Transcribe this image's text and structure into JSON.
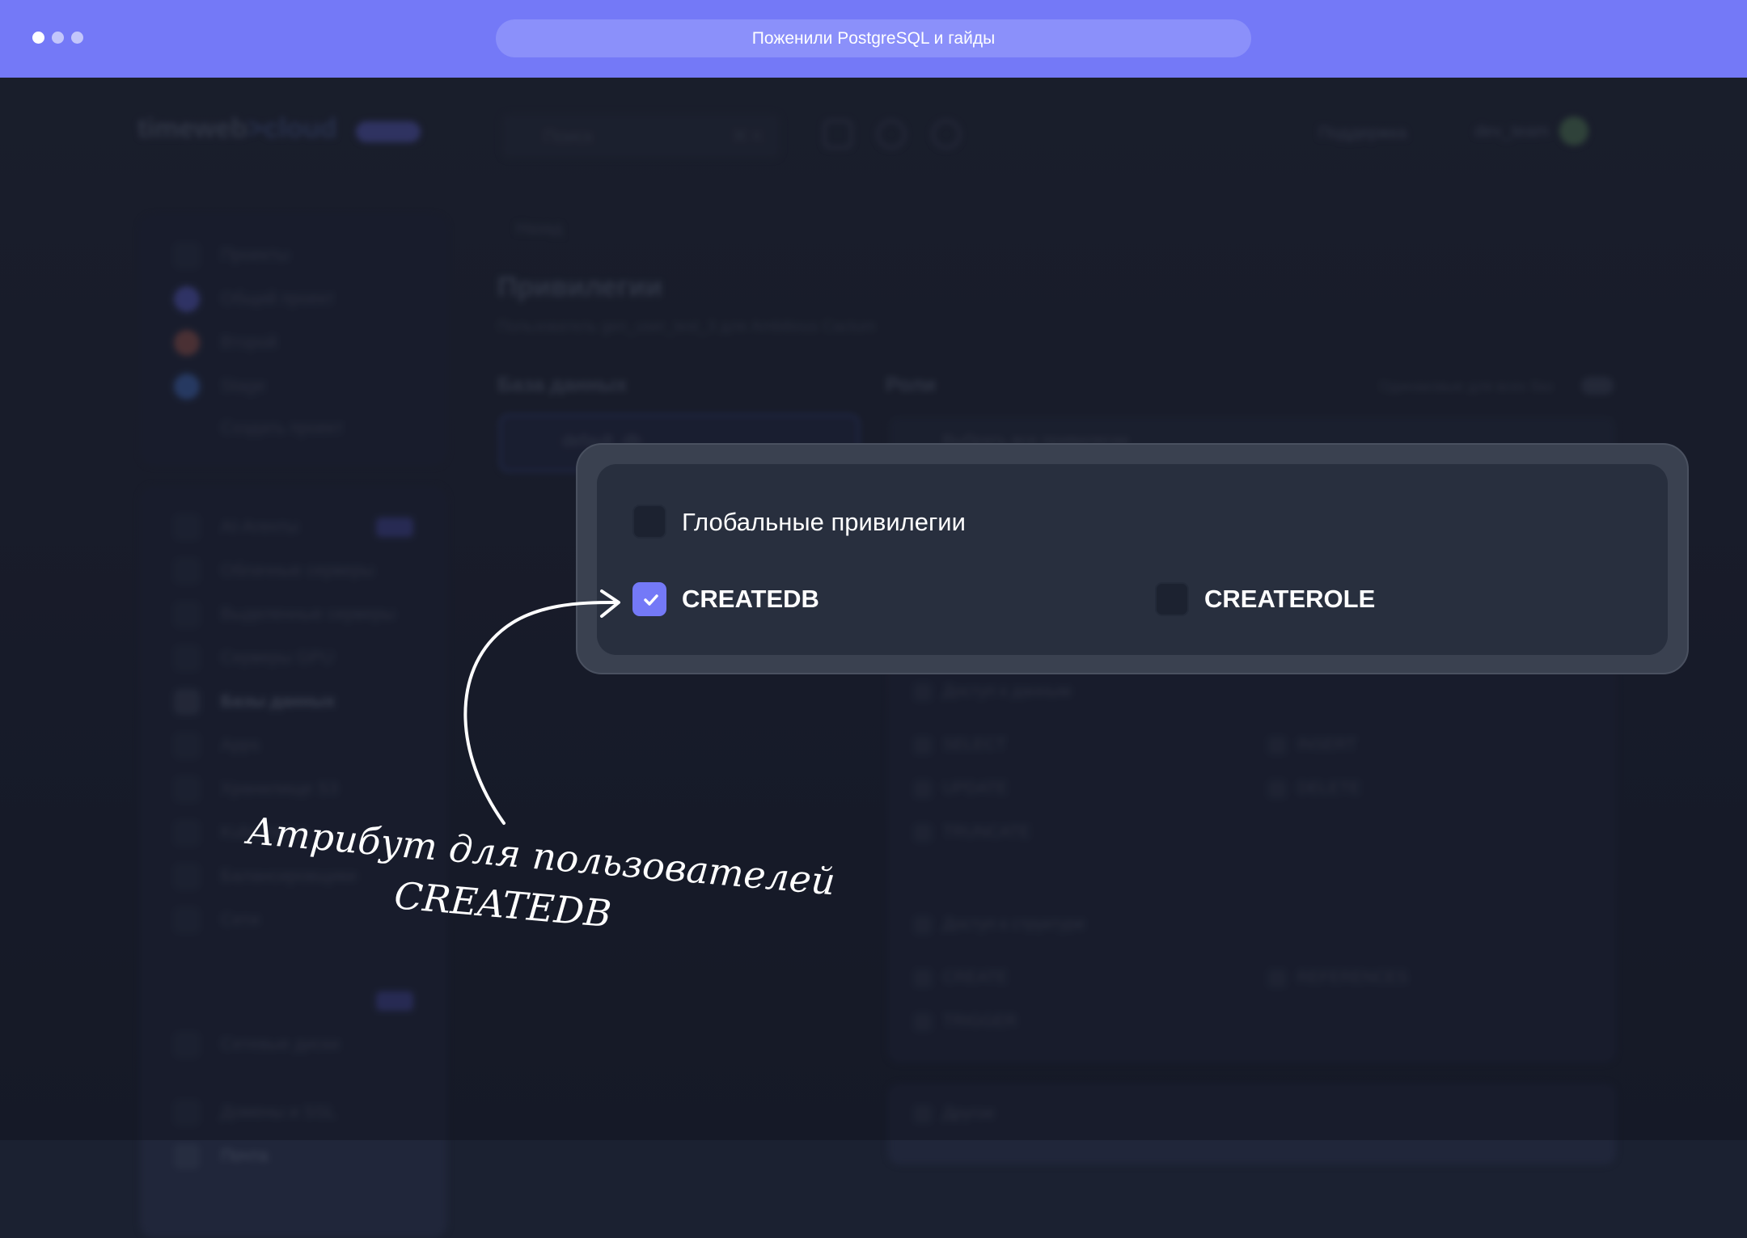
{
  "browser": {
    "url_title": "Поженили PostgreSQL и гайды"
  },
  "header": {
    "logo": "timeweb",
    "logo_suffix": ">cloud",
    "search_placeholder": "Поиск",
    "search_shortcut": "⌘ K",
    "support_label": "Поддержка",
    "user_name": "dev_team"
  },
  "sidebar": {
    "projects_title": "Проекты",
    "projects": [
      "Общий проект",
      "Второй",
      "Stage"
    ],
    "create_project": "Создать проект",
    "items": [
      "AI-Агенты",
      "Облачные серверы",
      "Выделенные серверы",
      "Серверы GPU",
      "Базы данных",
      "Apps",
      "Хранилище S3",
      "Kubernetes",
      "Балансировщики",
      "Сети",
      "Сетевые диски"
    ],
    "items_bottom": [
      "Домены и SSL",
      "Почта",
      "Личная сеть"
    ],
    "new_badge": "NEW"
  },
  "main": {
    "back_label": "Назад",
    "title": "Привилегии",
    "subtitle": "Пользователь gen_user_test_3 для Ambitious Cactum",
    "db_label": "База данных",
    "db_value": "default_db",
    "roles_label": "Роли",
    "same_for_all": "Одинаковые для всех баз",
    "roles_placeholder": "Выбрать все привилегии",
    "data_access": "Доступ к данным",
    "data_privs": [
      "SELECT",
      "INSERT",
      "UPDATE",
      "DELETE",
      "TRUNCATE"
    ],
    "structure_access": "Доступ к структуре",
    "structure_privs": [
      "CREATE",
      "REFERENCES",
      "TRIGGER"
    ],
    "other": "Другое"
  },
  "popup": {
    "global_label": "Глобальные привилегии",
    "createdb_label": "CREATEDB",
    "createdb_checked": true,
    "createrole_label": "CREATEROLE",
    "createrole_checked": false
  },
  "annotation": {
    "line1": "Атрибут для пользователей",
    "line2": "CREATEDB"
  },
  "colors": {
    "accent": "#7479f7",
    "chrome": "#7479f7"
  }
}
